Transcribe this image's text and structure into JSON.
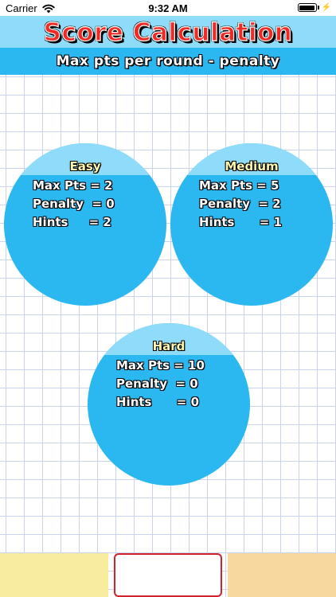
{
  "status_bar": {
    "carrier": "Carrier",
    "time": "9:32 AM"
  },
  "header": {
    "title": "Score Calculation",
    "subtitle": "Max pts per round - penalty"
  },
  "levels": [
    {
      "name": "Easy",
      "max_pts": "Max Pts = 2",
      "penalty": "Penalty  = 0",
      "hints": "Hints     = 2"
    },
    {
      "name": "Medium",
      "max_pts": "Max Pts = 5",
      "penalty": "Penalty  = 2",
      "hints": "Hints      = 1"
    },
    {
      "name": "Hard",
      "max_pts": "Max Pts = 10",
      "penalty": "Penalty  = 0",
      "hints": "Hints      = 0"
    }
  ],
  "colors": {
    "header_light": "#8edcf9",
    "header_dark": "#2bb8f1",
    "title_red": "#ef2a25",
    "level_name_yellow": "#fff6b0",
    "bottom_left": "#f8ec9f",
    "bottom_right": "#f7d9a0",
    "bottom_center_border": "#d3232a"
  },
  "icons": {
    "wifi": "wifi-icon",
    "battery": "battery-icon",
    "charging": "charging-bolt-icon"
  }
}
